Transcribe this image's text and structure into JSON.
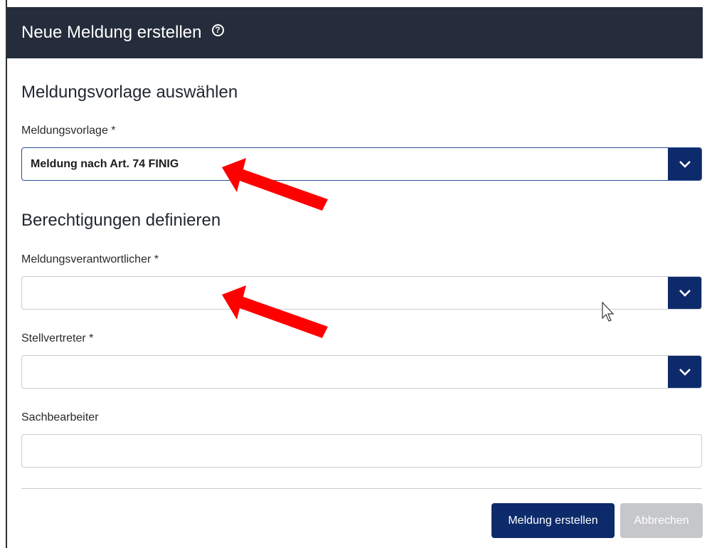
{
  "modal": {
    "title": "Neue Meldung erstellen",
    "help_icon": "?"
  },
  "section_template": {
    "title": "Meldungsvorlage auswählen",
    "field_label": "Meldungsvorlage *",
    "field_value": "Meldung nach Art. 74 FINIG"
  },
  "section_permissions": {
    "title": "Berechtigungen definieren",
    "responsible_label": "Meldungsverantwortlicher *",
    "responsible_value": "",
    "deputy_label": "Stellvertreter *",
    "deputy_value": "",
    "clerk_label": "Sachbearbeiter",
    "clerk_value": ""
  },
  "footer": {
    "create_label": "Meldung erstellen",
    "cancel_label": "Abbrechen"
  },
  "colors": {
    "header_bg": "#252d3c",
    "primary": "#0d2b6b",
    "disabled": "#c6c7cb",
    "annotation_arrow": "#ff0000"
  },
  "icons": {
    "help": "question-circle-icon",
    "dropdown": "chevron-down-icon",
    "annotation": "red-arrow-icon",
    "cursor": "mouse-pointer-icon"
  }
}
